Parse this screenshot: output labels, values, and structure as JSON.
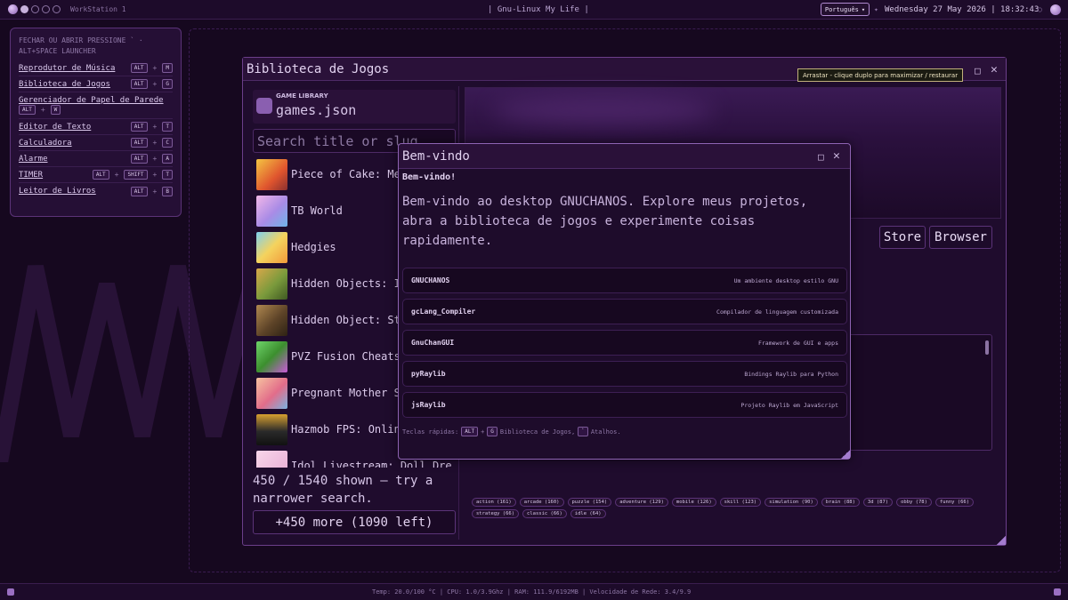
{
  "topbar": {
    "workspace": "WorkStation 1",
    "center_title": "| Gnu-Linux My Life |",
    "language": "Português",
    "datetime": "Wednesday 27 May 2026 | 18:32:43"
  },
  "shortcuts": {
    "header": "FECHAR OU ABRIR PRESSIONE ` · ALT+SPACE LAUNCHER",
    "items": [
      {
        "name": "Reprodutor de Música",
        "keys": [
          "ALT",
          "M"
        ]
      },
      {
        "name": "Biblioteca de Jogos",
        "keys": [
          "ALT",
          "G"
        ]
      },
      {
        "name": "Gerenciador de Papel de Parede",
        "keys": [
          "ALT",
          "W"
        ]
      },
      {
        "name": "Editor de Texto",
        "keys": [
          "ALT",
          "T"
        ]
      },
      {
        "name": "Calculadora",
        "keys": [
          "ALT",
          "C"
        ]
      },
      {
        "name": "Alarme",
        "keys": [
          "ALT",
          "A"
        ]
      },
      {
        "name": "TIMER",
        "keys": [
          "ALT",
          "SHIFT",
          "T"
        ]
      },
      {
        "name": "Leitor de Livros",
        "keys": [
          "ALT",
          "B"
        ]
      }
    ]
  },
  "library": {
    "window_title": "Biblioteca de Jogos",
    "tooltip": "Arrastar - clique duplo para maximizar / restaurar",
    "header_kicker": "GAME LIBRARY",
    "header_file": "games.json",
    "search_placeholder": "Search title or slug",
    "games": [
      {
        "title": "Piece of Cake: Merge and Bake"
      },
      {
        "title": "TB World"
      },
      {
        "title": "Hedgies"
      },
      {
        "title": "Hidden Objects: Isle"
      },
      {
        "title": "Hidden Object: Strange"
      },
      {
        "title": "PVZ Fusion Cheats"
      },
      {
        "title": "Pregnant Mother Simulator"
      },
      {
        "title": "Hazmob FPS: Online Shooter"
      },
      {
        "title": "Idol Livestream: Doll Dress"
      }
    ],
    "shown_text": "450 / 1540 shown — try a narrower search.",
    "more_button": "+450 more (1090 left)",
    "store_button": "Store",
    "browser_button": "Browser",
    "tags": [
      "action (161)",
      "arcade (160)",
      "puzzle (154)",
      "adventure (129)",
      "mobile (126)",
      "skill (123)",
      "simulation (90)",
      "brain (88)",
      "3d (87)",
      "obby (78)",
      "funny (66)",
      "strategy (66)",
      "classic (66)",
      "idle (64)"
    ]
  },
  "welcome": {
    "title": "Bem-vindo",
    "heading": "Bem-vindo!",
    "body": "Bem-vindo ao desktop GNUCHANOS. Explore meus projetos, abra a biblioteca de jogos e experimente coisas rapidamente.",
    "projects": [
      {
        "name": "GNUCHANOS",
        "desc": "Um ambiente desktop estilo GNU"
      },
      {
        "name": "gcLang_Compiler",
        "desc": "Compilador de linguagem customizada"
      },
      {
        "name": "GnuChanGUI",
        "desc": "Framework de GUI e apps"
      },
      {
        "name": "pyRaylib",
        "desc": "Bindings Raylib para Python"
      },
      {
        "name": "jsRaylib",
        "desc": "Projeto Raylib em JavaScript"
      }
    ],
    "hint_prefix": "Teclas rápidas:",
    "hint_key1": "ALT",
    "hint_key2": "G",
    "hint_mid": "Biblioteca de Jogos,",
    "hint_key3": "`",
    "hint_suffix": "Atalhos."
  },
  "statusbar": {
    "stats": "Temp: 20.0/100 °C | CPU: 1.0/3.9Ghz | RAM: 111.9/6192MB | Velocidade de Rede: 3.4/9.9"
  },
  "colors": {
    "background": "#16081f",
    "accent": "#8e63b3",
    "panel": "#250f35"
  }
}
